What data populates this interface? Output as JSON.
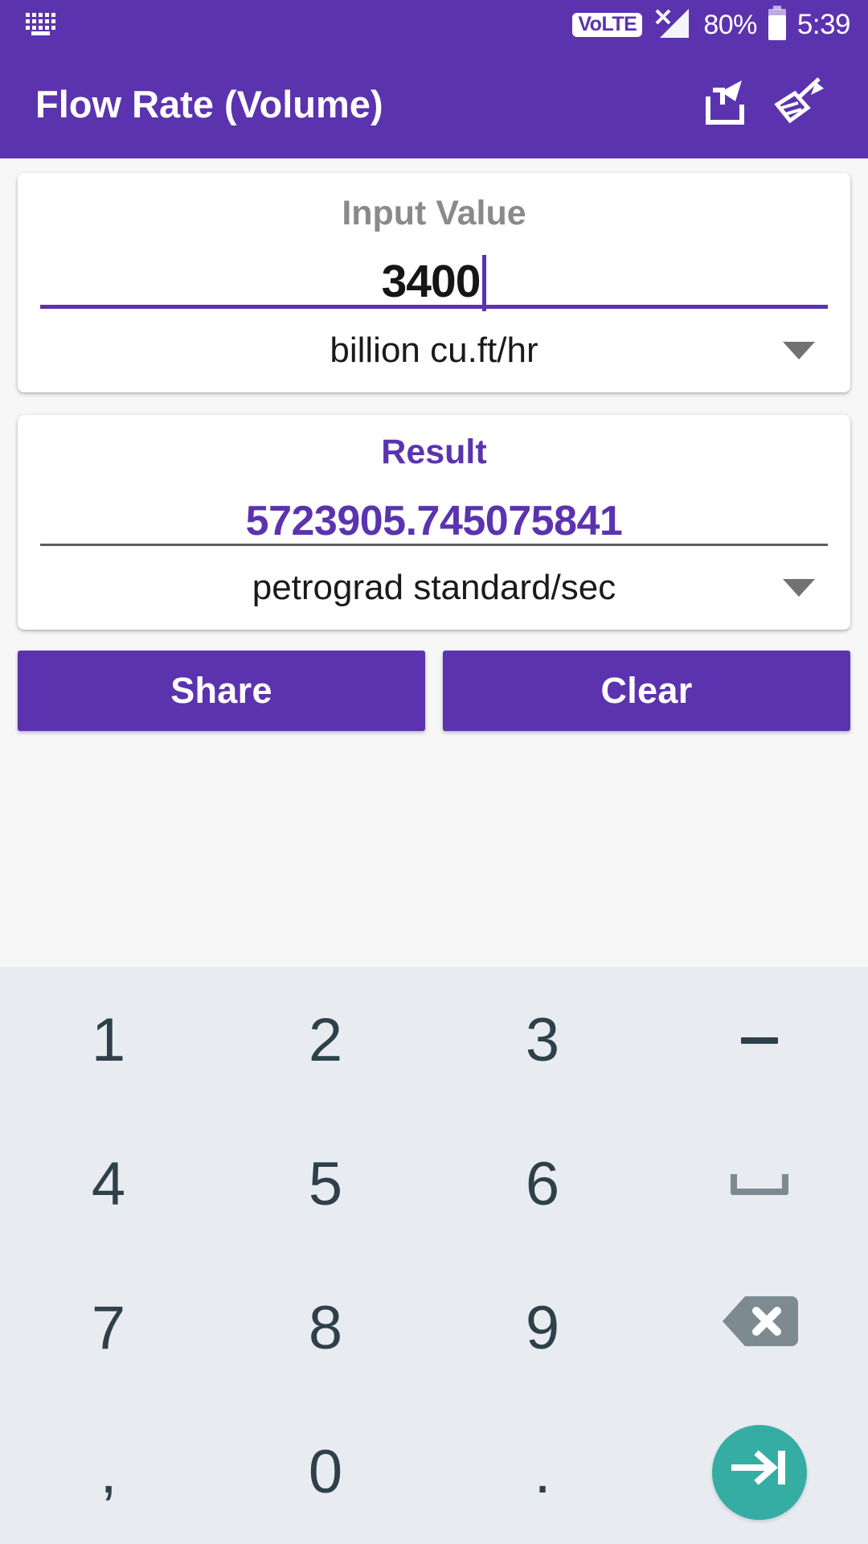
{
  "status_bar": {
    "keyboard_icon": "keyboard-icon",
    "volte_label": "VoLTE",
    "signal_icon": "signal-no-service-icon",
    "battery_percent": "80%",
    "battery_icon": "battery-icon",
    "time": "5:39"
  },
  "app_bar": {
    "title": "Flow Rate (Volume)",
    "share_icon": "share-icon",
    "clear_icon": "broom-icon"
  },
  "input_card": {
    "label": "Input Value",
    "value": "3400",
    "unit": "billion cu.ft/hr",
    "dropdown_icon": "chevron-down-icon"
  },
  "result_card": {
    "label": "Result",
    "value": "5723905.745075841",
    "unit": "petrograd standard/sec",
    "dropdown_icon": "chevron-down-icon"
  },
  "actions": {
    "share_label": "Share",
    "clear_label": "Clear"
  },
  "keypad": {
    "rows": [
      [
        {
          "label": "1",
          "name": "key-1",
          "type": "text"
        },
        {
          "label": "2",
          "name": "key-2",
          "type": "text"
        },
        {
          "label": "3",
          "name": "key-3",
          "type": "text"
        },
        {
          "label": "-",
          "name": "key-minus",
          "type": "minus"
        }
      ],
      [
        {
          "label": "4",
          "name": "key-4",
          "type": "text"
        },
        {
          "label": "5",
          "name": "key-5",
          "type": "text"
        },
        {
          "label": "6",
          "name": "key-6",
          "type": "text"
        },
        {
          "label": "",
          "name": "key-space",
          "type": "space"
        }
      ],
      [
        {
          "label": "7",
          "name": "key-7",
          "type": "text"
        },
        {
          "label": "8",
          "name": "key-8",
          "type": "text"
        },
        {
          "label": "9",
          "name": "key-9",
          "type": "text"
        },
        {
          "label": "",
          "name": "key-backspace",
          "type": "backspace"
        }
      ],
      [
        {
          "label": ",",
          "name": "key-comma",
          "type": "text"
        },
        {
          "label": "0",
          "name": "key-0",
          "type": "text"
        },
        {
          "label": ".",
          "name": "key-period",
          "type": "text"
        },
        {
          "label": "",
          "name": "key-enter",
          "type": "enter"
        }
      ]
    ]
  },
  "colors": {
    "primary": "#5B33AF",
    "keypad_bg": "#e8ecf1",
    "key_text": "#2e4049",
    "enter_button": "#35ada3",
    "backspace": "#7d8a92",
    "label_gray": "#8a8a8a"
  }
}
